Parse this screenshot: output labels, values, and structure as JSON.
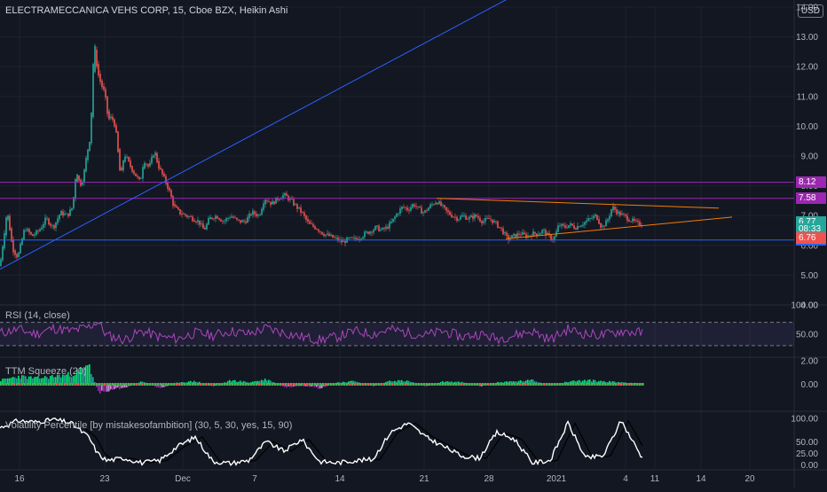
{
  "chart_title": "ELECTRAMECCANICA VEHS CORP, 15, Cboe BZX, Heikin Ashi",
  "currency": "USD",
  "colors": {
    "background": "#131722",
    "up": "#26a69a",
    "down": "#ef5350",
    "trend_blue": "#2962ff",
    "purple": "#9c27b0",
    "orange": "#f57c00",
    "rsi": "#ab47bc",
    "white": "#ffffff"
  },
  "chart_data": [
    {
      "type": "candlestick",
      "name": "main",
      "ylim": [
        4.0,
        14.0
      ],
      "y_ticks": [
        4,
        5,
        6,
        7,
        8,
        9,
        10,
        11,
        12,
        13,
        14
      ],
      "y_tick_labels": [
        "4.00",
        "5.00",
        "6.00",
        "7.00",
        "8.00",
        "9.00",
        "10.00",
        "11.00",
        "12.00",
        "13.00",
        "14.00"
      ],
      "x_tick_labels": [
        "16",
        "23",
        "Dec",
        "7",
        "14",
        "21",
        "28",
        "2021",
        "4",
        "11",
        "14",
        "20"
      ],
      "path": [
        [
          0,
          5.3
        ],
        [
          8,
          7.2
        ],
        [
          14,
          5.9
        ],
        [
          20,
          5.6
        ],
        [
          28,
          6.6
        ],
        [
          36,
          6.3
        ],
        [
          44,
          6.5
        ],
        [
          52,
          6.9
        ],
        [
          60,
          6.6
        ],
        [
          68,
          7.1
        ],
        [
          76,
          7.0
        ],
        [
          82,
          7.3
        ],
        [
          86,
          8.6
        ],
        [
          90,
          8.0
        ],
        [
          94,
          8.3
        ],
        [
          98,
          9.1
        ],
        [
          102,
          9.7
        ],
        [
          106,
          12.9
        ],
        [
          110,
          11.8
        ],
        [
          114,
          11.4
        ],
        [
          118,
          11.1
        ],
        [
          122,
          10.2
        ],
        [
          126,
          10.3
        ],
        [
          130,
          10.0
        ],
        [
          136,
          8.2
        ],
        [
          140,
          9.1
        ],
        [
          146,
          8.7
        ],
        [
          152,
          8.4
        ],
        [
          158,
          8.1
        ],
        [
          162,
          8.9
        ],
        [
          168,
          8.6
        ],
        [
          174,
          9.2
        ],
        [
          178,
          8.7
        ],
        [
          184,
          8.3
        ],
        [
          190,
          7.9
        ],
        [
          196,
          7.3
        ],
        [
          202,
          7.1
        ],
        [
          210,
          7.0
        ],
        [
          218,
          6.9
        ],
        [
          224,
          6.8
        ],
        [
          230,
          6.5
        ],
        [
          236,
          6.9
        ],
        [
          244,
          7.0
        ],
        [
          252,
          6.8
        ],
        [
          260,
          7.0
        ],
        [
          268,
          6.8
        ],
        [
          276,
          6.8
        ],
        [
          284,
          7.1
        ],
        [
          292,
          7.0
        ],
        [
          298,
          7.6
        ],
        [
          306,
          7.4
        ],
        [
          314,
          7.6
        ],
        [
          320,
          7.7
        ],
        [
          328,
          7.5
        ],
        [
          334,
          7.3
        ],
        [
          340,
          7.1
        ],
        [
          348,
          6.7
        ],
        [
          356,
          6.6
        ],
        [
          364,
          6.4
        ],
        [
          372,
          6.3
        ],
        [
          380,
          6.2
        ],
        [
          386,
          6.1
        ],
        [
          392,
          6.2
        ],
        [
          400,
          6.2
        ],
        [
          406,
          6.3
        ],
        [
          412,
          6.4
        ],
        [
          418,
          6.5
        ],
        [
          424,
          6.6
        ],
        [
          430,
          6.5
        ],
        [
          436,
          6.6
        ],
        [
          442,
          6.8
        ],
        [
          448,
          7.1
        ],
        [
          454,
          7.3
        ],
        [
          460,
          7.2
        ],
        [
          466,
          7.4
        ],
        [
          472,
          7.2
        ],
        [
          478,
          7.1
        ],
        [
          484,
          7.3
        ],
        [
          492,
          7.5
        ],
        [
          498,
          7.3
        ],
        [
          504,
          7.1
        ],
        [
          510,
          7.0
        ],
        [
          516,
          6.9
        ],
        [
          522,
          7.0
        ],
        [
          528,
          6.9
        ],
        [
          536,
          7.0
        ],
        [
          544,
          6.8
        ],
        [
          552,
          6.9
        ],
        [
          560,
          6.7
        ],
        [
          566,
          6.5
        ],
        [
          572,
          6.2
        ],
        [
          578,
          6.3
        ],
        [
          586,
          6.4
        ],
        [
          594,
          6.3
        ],
        [
          600,
          6.4
        ],
        [
          606,
          6.4
        ],
        [
          612,
          6.5
        ],
        [
          618,
          6.3
        ],
        [
          624,
          6.2
        ],
        [
          630,
          6.7
        ],
        [
          636,
          6.6
        ],
        [
          642,
          6.7
        ],
        [
          648,
          6.6
        ],
        [
          654,
          6.7
        ],
        [
          660,
          6.8
        ],
        [
          666,
          6.9
        ],
        [
          672,
          7.0
        ],
        [
          678,
          6.6
        ],
        [
          684,
          6.8
        ],
        [
          690,
          7.3
        ],
        [
          696,
          7.1
        ],
        [
          702,
          7.0
        ],
        [
          708,
          6.9
        ],
        [
          714,
          6.8
        ],
        [
          720,
          6.7
        ],
        [
          724,
          6.77
        ]
      ],
      "horizontal_lines": [
        {
          "value": 8.12,
          "label": "8.12",
          "color": "#9c27b0"
        },
        {
          "value": 7.58,
          "label": "7.58",
          "color": "#9c27b0"
        },
        {
          "value": 6.18,
          "label": "6.18",
          "color": "#2962ff"
        }
      ],
      "trend_lines": [
        {
          "color": "#2962ff",
          "from": [
            0,
            5.2
          ],
          "to": [
            580,
            14.4
          ]
        },
        {
          "color": "#f57c00",
          "from": [
            492,
            7.58
          ],
          "to": [
            810,
            7.25
          ]
        },
        {
          "color": "#f57c00",
          "from": [
            570,
            6.22
          ],
          "to": [
            825,
            6.95
          ]
        }
      ],
      "price_labels": [
        {
          "text": "6.77",
          "value": 6.77,
          "color": "#26a69a"
        },
        {
          "text": "08:33",
          "value": 6.55,
          "color": "#26a69a"
        },
        {
          "text": "6.76",
          "value": 6.25,
          "color": "#ef5350"
        }
      ]
    },
    {
      "type": "line",
      "name": "RSI (14, close)",
      "ylim": [
        10,
        100
      ],
      "y_tick_labels": [
        "100.00",
        "50.00"
      ],
      "y_ticks": [
        100,
        50
      ],
      "bands": [
        70,
        30
      ],
      "x": [
        0,
        20,
        40,
        60,
        80,
        100,
        110,
        120,
        140,
        160,
        180,
        200,
        220,
        240,
        260,
        280,
        300,
        320,
        340,
        360,
        380,
        400,
        420,
        440,
        460,
        480,
        500,
        520,
        540,
        560,
        580,
        600,
        620,
        640,
        660,
        680,
        700,
        724
      ],
      "values": [
        52,
        58,
        50,
        60,
        55,
        62,
        72,
        48,
        40,
        55,
        45,
        42,
        52,
        48,
        55,
        50,
        60,
        52,
        45,
        40,
        45,
        55,
        50,
        58,
        52,
        48,
        55,
        45,
        50,
        42,
        48,
        55,
        40,
        58,
        50,
        48,
        55,
        52
      ]
    },
    {
      "type": "bar",
      "name": "TTM Squeeze (20)",
      "ylim": [
        -2.3,
        2.3
      ],
      "y_tick_labels": [
        "2.00",
        "0.00"
      ],
      "y_ticks": [
        2,
        0
      ],
      "x": [
        0,
        20,
        40,
        60,
        80,
        100,
        110,
        120,
        140,
        160,
        180,
        200,
        220,
        240,
        260,
        280,
        300,
        320,
        340,
        360,
        380,
        400,
        420,
        440,
        460,
        480,
        500,
        520,
        540,
        560,
        580,
        600,
        620,
        640,
        660,
        680,
        700,
        724
      ],
      "values": [
        0.4,
        0.8,
        0.6,
        0.8,
        1.0,
        1.8,
        -0.8,
        -0.6,
        -0.3,
        0.3,
        -0.4,
        0.2,
        0.3,
        -0.2,
        0.4,
        0.2,
        0.5,
        -0.3,
        -0.2,
        -0.4,
        0.2,
        0.3,
        -0.2,
        0.4,
        0.3,
        -0.2,
        0.3,
        0.2,
        -0.2,
        0.2,
        0.3,
        0.4,
        -0.2,
        0.3,
        0.4,
        0.3,
        0.2,
        0.1
      ]
    },
    {
      "type": "line",
      "name": "Volatility Percentile [by mistakesofambition] (30, 5, 30, yes, 15, 90)",
      "ylim": [
        -10,
        115
      ],
      "y_tick_labels": [
        "100.00",
        "50.00",
        "25.00",
        "0.00"
      ],
      "y_ticks": [
        100,
        50,
        25,
        0
      ],
      "x": [
        0,
        20,
        40,
        60,
        80,
        100,
        110,
        120,
        140,
        160,
        180,
        200,
        220,
        240,
        260,
        280,
        300,
        320,
        340,
        360,
        380,
        400,
        420,
        440,
        460,
        480,
        500,
        520,
        540,
        560,
        580,
        600,
        620,
        640,
        660,
        680,
        700,
        724
      ],
      "values": [
        80,
        95,
        92,
        98,
        90,
        60,
        25,
        10,
        15,
        5,
        10,
        40,
        60,
        8,
        4,
        10,
        50,
        30,
        55,
        8,
        5,
        10,
        12,
        70,
        90,
        60,
        40,
        20,
        15,
        70,
        55,
        5,
        10,
        90,
        15,
        20,
        95,
        15
      ]
    }
  ]
}
